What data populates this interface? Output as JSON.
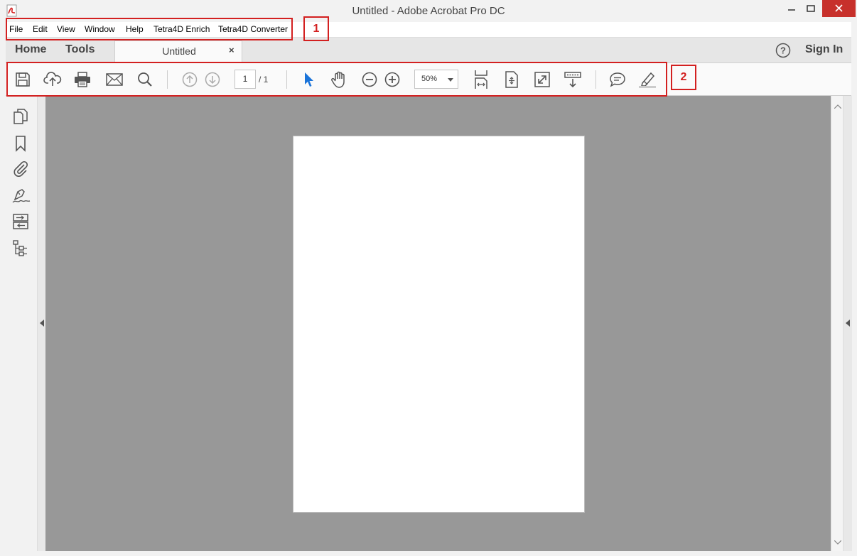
{
  "window": {
    "title": "Untitled - Adobe Acrobat Pro DC",
    "accent_close": "#c7302b"
  },
  "menu": {
    "items": [
      {
        "label": "File"
      },
      {
        "label": "Edit"
      },
      {
        "label": "View"
      },
      {
        "label": "Window"
      },
      {
        "label": "Help"
      },
      {
        "label": "Tetra4D Enrich"
      },
      {
        "label": "Tetra4D Converter"
      }
    ]
  },
  "tabs": {
    "home": "Home",
    "tools": "Tools",
    "document": "Untitled",
    "close_glyph": "×",
    "help_glyph": "?",
    "sign_in": "Sign In"
  },
  "toolbar": {
    "icons": [
      "save-icon",
      "cloud-upload-icon",
      "print-icon",
      "email-icon",
      "search-icon",
      "page-up-icon",
      "page-down-icon",
      "select-pointer-icon",
      "hand-tool-icon",
      "zoom-out-icon",
      "zoom-in-icon",
      "fit-width-icon",
      "fit-page-icon",
      "full-screen-icon",
      "read-mode-icon",
      "comment-icon",
      "highlight-icon"
    ],
    "page_current": "1",
    "page_total": "/ 1",
    "zoom": "50%"
  },
  "left_rail": {
    "icons": [
      "page-thumbnails-icon",
      "bookmark-icon",
      "attachment-icon",
      "signature-icon",
      "layers-icon",
      "content-tree-icon"
    ]
  },
  "annotations": {
    "box1": "1",
    "box2": "2",
    "color": "#d32020"
  }
}
